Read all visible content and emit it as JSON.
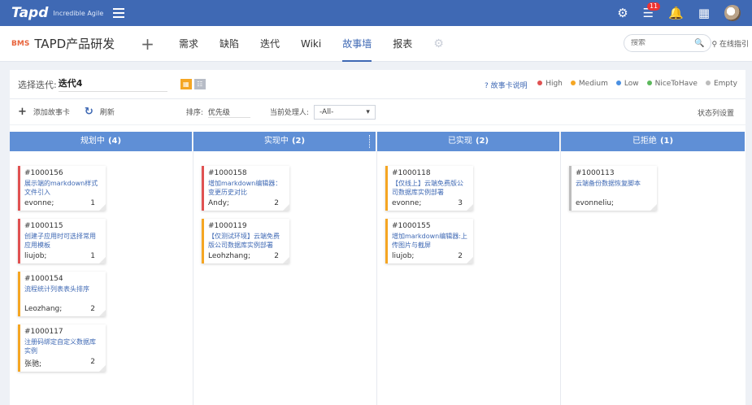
{
  "topbar": {
    "logo": "Tapd",
    "tagline": "Incredible Agile",
    "notification_count": "11"
  },
  "nav": {
    "project_icon": "BMS",
    "project_name": "TAPD产品研发",
    "items": [
      {
        "label": "需求"
      },
      {
        "label": "缺陷"
      },
      {
        "label": "迭代"
      },
      {
        "label": "Wiki"
      },
      {
        "label": "故事墙"
      },
      {
        "label": "报表"
      }
    ],
    "search_placeholder": "搜索",
    "help_label": "在线指引"
  },
  "filter": {
    "iteration_label": "选择迭代:",
    "iteration_value": "迭代4",
    "story_help": "故事卡说明",
    "legend": [
      {
        "label": "High",
        "color": "#e05252"
      },
      {
        "label": "Medium",
        "color": "#f5a623"
      },
      {
        "label": "Low",
        "color": "#4a90e2"
      },
      {
        "label": "NiceToHave",
        "color": "#5cb85c"
      },
      {
        "label": "Empty",
        "color": "#bcbcbc"
      }
    ]
  },
  "toolbar": {
    "add_card": "添加故事卡",
    "refresh": "刷新",
    "sort_label": "排序:",
    "sort_value": "优先级",
    "owner_label": "当前处理人:",
    "owner_value": "-All-",
    "status_setting": "状态列设置"
  },
  "columns": [
    {
      "name": "规划中",
      "count": "(4)",
      "cards": [
        {
          "id": "#1000156",
          "title": "展示端的markdown样式文件引入",
          "owner": "evonne;",
          "count": "1",
          "priority": "high"
        },
        {
          "id": "#1000115",
          "title": "创建子应用时可选择常用应用模板",
          "owner": "liujob;",
          "count": "1",
          "priority": "high"
        },
        {
          "id": "#1000154",
          "title": "流程统计列表表头排序",
          "owner": "Leozhang;",
          "count": "2",
          "priority": "medium"
        },
        {
          "id": "#1000117",
          "title": "注册码绑定自定义数据库实例",
          "owner": "张驰;",
          "count": "2",
          "priority": "medium"
        }
      ]
    },
    {
      "name": "实现中",
      "count": "(2)",
      "cards": [
        {
          "id": "#1000158",
          "title": "增加markdown编辑器：变更历史对比",
          "owner": "Andy;",
          "count": "2",
          "priority": "high"
        },
        {
          "id": "#1000119",
          "title": "【仅测试环境】云端免费版公司数据库实例部署",
          "owner": "Leohzhang;",
          "count": "2",
          "priority": "medium"
        }
      ]
    },
    {
      "name": "已实现",
      "count": "(2)",
      "cards": [
        {
          "id": "#1000118",
          "title": "【仅线上】云端免费版公司数据库实例部署",
          "owner": "evonne;",
          "count": "3",
          "priority": "medium"
        },
        {
          "id": "#1000155",
          "title": "增加markdown编辑器:上传图片与截屏",
          "owner": "liujob;",
          "count": "2",
          "priority": "medium"
        }
      ]
    },
    {
      "name": "已拒绝",
      "count": "(1)",
      "cards": [
        {
          "id": "#1000113",
          "title": "云端备份数据恢复脚本",
          "owner": "evonneliu;",
          "count": "",
          "priority": "empty"
        }
      ]
    }
  ]
}
